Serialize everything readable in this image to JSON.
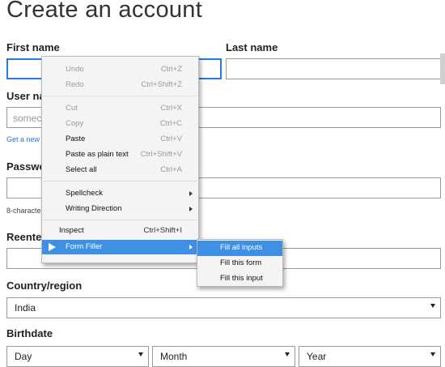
{
  "page": {
    "title": "Create an account",
    "first_name_label": "First name",
    "last_name_label": "Last name",
    "username_label": "User na",
    "username_placeholder": "somec",
    "get_new_link": "Get a new",
    "password_label": "Passwo",
    "password_hint": "8-characte",
    "reenter_label": "Reenter",
    "country_label": "Country/region",
    "country_value": "India",
    "birthdate_label": "Birthdate",
    "day_value": "Day",
    "month_value": "Month",
    "year_value": "Year"
  },
  "context_menu": {
    "items": [
      {
        "label": "Undo",
        "shortcut": "Ctrl+Z",
        "enabled": false
      },
      {
        "label": "Redo",
        "shortcut": "Ctrl+Shift+Z",
        "enabled": false
      },
      {
        "label": "Cut",
        "shortcut": "Ctrl+X",
        "enabled": false
      },
      {
        "label": "Copy",
        "shortcut": "Ctrl+C",
        "enabled": false
      },
      {
        "label": "Paste",
        "shortcut": "Ctrl+V",
        "enabled": true
      },
      {
        "label": "Paste as plain text",
        "shortcut": "Ctrl+Shift+V",
        "enabled": true
      },
      {
        "label": "Select all",
        "shortcut": "Ctrl+A",
        "enabled": true
      },
      {
        "label": "Spellcheck",
        "shortcut": "",
        "enabled": true
      },
      {
        "label": "Writing Direction",
        "shortcut": "",
        "enabled": true
      },
      {
        "label": "Inspect",
        "shortcut": "Ctrl+Shift+I",
        "enabled": true
      },
      {
        "label": "Form Filler",
        "shortcut": "",
        "enabled": true
      }
    ],
    "form_filler_icon": "form-filler-icon",
    "highlight_color": "#3e90e4"
  },
  "submenu": {
    "items": [
      {
        "label": "Fill all inputs"
      },
      {
        "label": "Fill this form"
      },
      {
        "label": "Fill this input"
      }
    ]
  },
  "colors": {
    "focus_border": "#2a79d8",
    "link": "#2672ec"
  }
}
